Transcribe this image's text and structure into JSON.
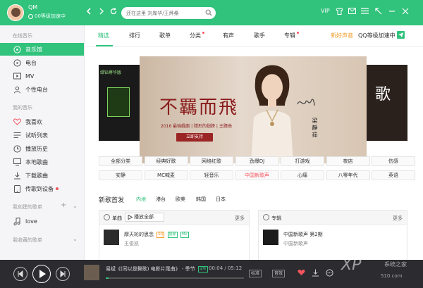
{
  "header": {
    "username": "QM",
    "level_text": "00等级加速中",
    "search_placeholder": "还在这里 刘库华/王烨桑",
    "vip": "VIP"
  },
  "sidebar": {
    "section_online": "在线音乐",
    "online_items": [
      {
        "label": "音乐馆",
        "icon": "music-hall-icon"
      },
      {
        "label": "电台",
        "icon": "radio-icon"
      },
      {
        "label": "MV",
        "icon": "mv-icon"
      },
      {
        "label": "个性电台",
        "icon": "personal-radio-icon"
      }
    ],
    "section_mine": "我的音乐",
    "mine_items": [
      {
        "label": "我喜欢",
        "icon": "heart-icon"
      },
      {
        "label": "试听列表",
        "icon": "list-icon"
      },
      {
        "label": "播放历史",
        "icon": "history-icon"
      },
      {
        "label": "本地歌曲",
        "icon": "computer-icon"
      },
      {
        "label": "下载歌曲",
        "icon": "download-icon"
      },
      {
        "label": "传歌到设备",
        "icon": "device-icon"
      }
    ],
    "section_created": "我创建的歌单",
    "created_items": [
      {
        "label": "love",
        "icon": "note-icon"
      }
    ],
    "section_collected": "我收藏的歌单"
  },
  "tabs": [
    {
      "label": "精选",
      "dot": false
    },
    {
      "label": "排行",
      "dot": false
    },
    {
      "label": "歌单",
      "dot": false
    },
    {
      "label": "分类",
      "dot": true
    },
    {
      "label": "有声",
      "dot": false
    },
    {
      "label": "歌手",
      "dot": false
    },
    {
      "label": "专辑",
      "dot": true
    }
  ],
  "tab_links": {
    "new_voice": "新好声音",
    "qq_level": "QQ等级加速中"
  },
  "banner": {
    "title": "不羈而飛",
    "subtitle": "2016 最強戲劇 | 隱形的翅膀 | 主題曲",
    "button": "立即支持",
    "artist": "梁靜茹",
    "left_badge": "绿钻尊华版",
    "right_word": "歌"
  },
  "categories": [
    [
      {
        "label": "全部分类",
        "hot": false
      },
      {
        "label": "经典好歌",
        "hot": false
      },
      {
        "label": "网络红歌",
        "hot": false
      },
      {
        "label": "劲爆DJ",
        "hot": false
      },
      {
        "label": "打游戏",
        "hot": false
      },
      {
        "label": "夜店",
        "hot": false
      },
      {
        "label": "伤感",
        "hot": false
      }
    ],
    [
      {
        "label": "安静",
        "hot": false
      },
      {
        "label": "MC喊麦",
        "hot": false
      },
      {
        "label": "轻音乐",
        "hot": false
      },
      {
        "label": "中国新歌声",
        "hot": true
      },
      {
        "label": "心痛",
        "hot": false
      },
      {
        "label": "八零年代",
        "hot": false
      },
      {
        "label": "英语",
        "hot": false
      }
    ]
  ],
  "new_songs": {
    "title": "新歌首发",
    "tabs": [
      "内地",
      "港台",
      "欧美",
      "韩国",
      "日本"
    ],
    "active_tab": 0,
    "single_label": "单曲",
    "play_all": "播放全部",
    "more": "更多",
    "song_name": "摩天轮的思念",
    "song_tags": [
      "SQ",
      "独家",
      "MV"
    ],
    "song_artist": "王俊凯",
    "album_label": "专辑",
    "album_name": "中国新歌声 第2期",
    "album_artist": "中国新歌声"
  },
  "player": {
    "title": "易斌《(同以是舞歌) 电影片尾曲》 - 季节",
    "tag": "试听",
    "time": "00:04 / 05:12",
    "progress": 0.02,
    "quality": "标准",
    "effect": "音效"
  },
  "watermark": {
    "brand": "XP",
    "text": "系统之家",
    "url": "510.com"
  },
  "colors": {
    "accent": "#31c27c",
    "hot": "#f6545e",
    "player_bg": "#2c2c30"
  }
}
